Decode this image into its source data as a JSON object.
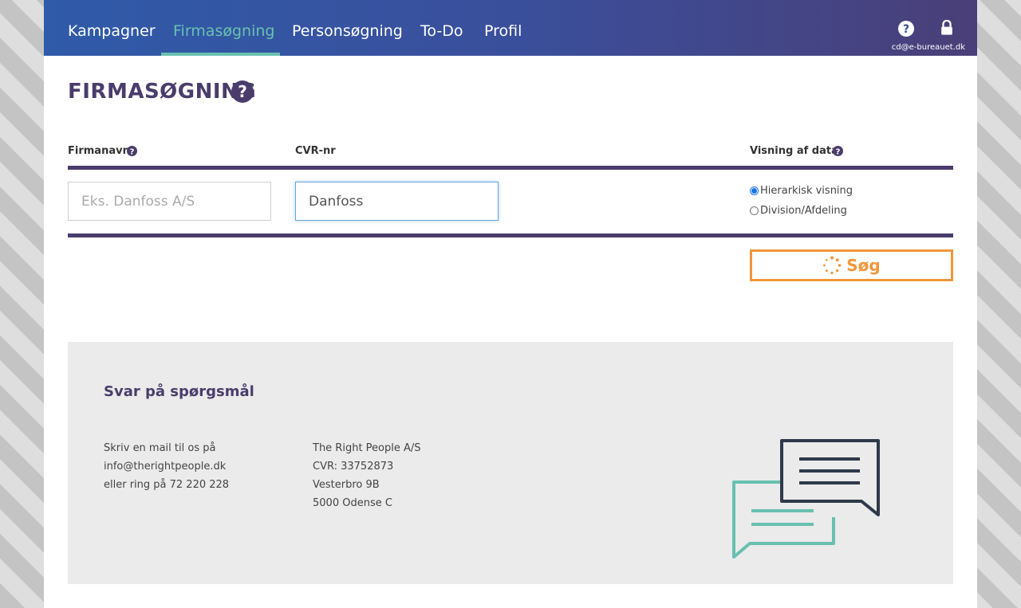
{
  "nav": {
    "items": [
      {
        "label": "Kampagner"
      },
      {
        "label": "Firmasøgning"
      },
      {
        "label": "Personsøgning"
      },
      {
        "label": "To-Do"
      },
      {
        "label": "Profil"
      }
    ],
    "user_email": "cd@e-bureauet.dk"
  },
  "page": {
    "title": "FIRMASØGNING"
  },
  "search": {
    "firmanavn_label": "Firmanavn",
    "firmanavn_placeholder": "Eks. Danfoss A/S",
    "firmanavn_value": "",
    "cvr_label": "CVR-nr",
    "cvr_value": "Danfoss",
    "view_label": "Visning af data",
    "options": [
      {
        "label": "Hierarkisk visning",
        "checked": true
      },
      {
        "label": "Division/Afdeling",
        "checked": false
      }
    ],
    "button_label": "Søg"
  },
  "footer": {
    "title": "Svar på spørgsmål",
    "contact_lines": [
      "Skriv en mail til os på",
      "info@therightpeople.dk",
      "eller ring på 72 220 228"
    ],
    "company_lines": [
      "The Right People A/S",
      "CVR: 33752873",
      "Vesterbro 9B",
      "5000 Odense C"
    ]
  },
  "colors": {
    "brand_purple": "#4a3d6c",
    "accent_teal": "#69c0b0",
    "accent_orange": "#f0963a",
    "header_gradient_start": "#2f5ba8",
    "header_gradient_end": "#4a3f78"
  }
}
